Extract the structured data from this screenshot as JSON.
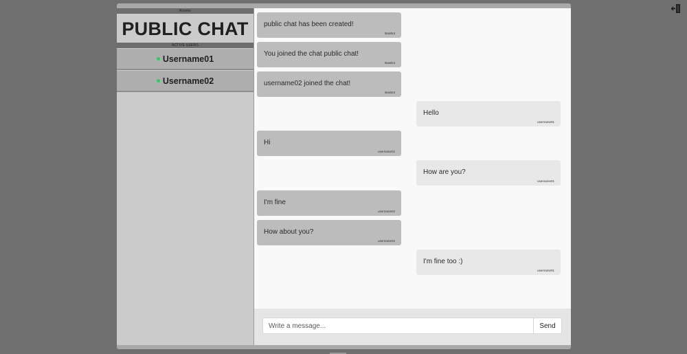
{
  "sidebar": {
    "rooms_label": "Rooms",
    "room_title": "PUBLIC CHAT",
    "active_users_label": "ACTIVE USERS",
    "users": [
      {
        "name": "Username01",
        "status_color": "#2ecc5f"
      },
      {
        "name": "Username02",
        "status_color": "#2ecc5f"
      }
    ]
  },
  "messages": [
    {
      "text": "public chat has been created!",
      "author": "BanBot",
      "side": "left"
    },
    {
      "text": "You joined the chat public chat!",
      "author": "BanBot",
      "side": "left"
    },
    {
      "text": "username02 joined the chat!",
      "author": "BanBot",
      "side": "left"
    },
    {
      "text": "Hello",
      "author": "username01",
      "side": "right"
    },
    {
      "text": "Hi",
      "author": "username02",
      "side": "left"
    },
    {
      "text": "How are you?",
      "author": "username01",
      "side": "right"
    },
    {
      "text": "I'm fine",
      "author": "username02",
      "side": "left"
    },
    {
      "text": "How about you?",
      "author": "username02",
      "side": "left"
    },
    {
      "text": "I'm fine too :)",
      "author": "username01",
      "side": "right"
    }
  ],
  "composer": {
    "placeholder": "Write a message...",
    "value": "",
    "send_label": "Send"
  },
  "icons": {
    "top_right": "exit-icon"
  }
}
